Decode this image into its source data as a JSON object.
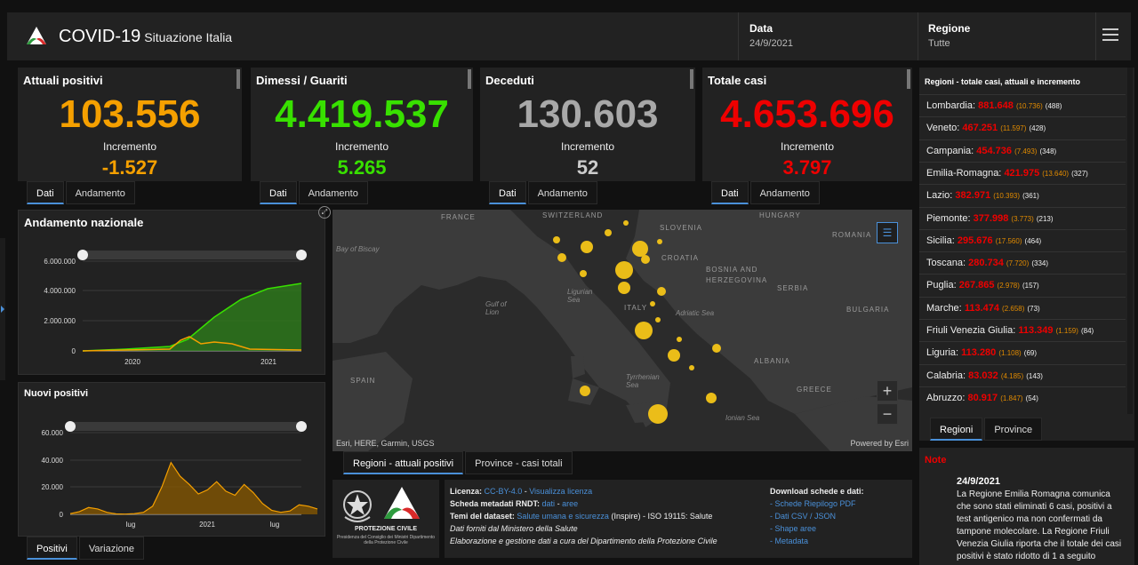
{
  "header": {
    "title": "COVID-19",
    "subtitle": "Situazione Italia",
    "date_label": "Data",
    "date_value": "24/9/2021",
    "region_label": "Regione",
    "region_value": "Tutte"
  },
  "stats": [
    {
      "title": "Attuali positivi",
      "value": "103.556",
      "inc_label": "Incremento",
      "inc": "-1.527",
      "color": "#f5a000"
    },
    {
      "title": "Dimessi / Guariti",
      "value": "4.419.537",
      "inc_label": "Incremento",
      "inc": "5.265",
      "color": "#38e000"
    },
    {
      "title": "Deceduti",
      "value": "130.603",
      "inc_label": "Incremento",
      "inc": "52",
      "color": "#a8a8a8"
    },
    {
      "title": "Totale casi",
      "value": "4.653.696",
      "inc_label": "Incremento",
      "inc": "3.797",
      "color": "#ee0000"
    }
  ],
  "stat_tabs": {
    "dati": "Dati",
    "andamento": "Andamento"
  },
  "trend_chart": {
    "title": "Andamento nazionale",
    "chart_data": {
      "type": "area",
      "x": [
        "2020-02",
        "2020-06",
        "2020-10",
        "2020-12",
        "2021-03",
        "2021-06",
        "2021-09"
      ],
      "yticks": [
        "6.000.000",
        "4.000.000",
        "2.000.000",
        "0"
      ],
      "xticks": [
        "2020",
        "2021"
      ],
      "ylim": [
        0,
        6000000
      ],
      "series": [
        {
          "values": [
            0,
            150000,
            300000,
            1200000,
            2500000,
            3900000,
            4420000
          ],
          "color": "#38e000"
        },
        {
          "values": [
            0,
            20000,
            200000,
            700000,
            550000,
            200000,
            103556
          ],
          "color": "#f5a000"
        }
      ]
    }
  },
  "new_chart": {
    "title": "Nuovi positivi",
    "chart_data": {
      "type": "area",
      "yticks": [
        "60.000",
        "40.000",
        "20.000",
        "0"
      ],
      "xticks": [
        "lug",
        "2021",
        "lug"
      ],
      "ylim": [
        0,
        60000
      ],
      "values": [
        500,
        2000,
        5000,
        4000,
        1500,
        300,
        200,
        500,
        1500,
        6000,
        20000,
        38000,
        28000,
        22000,
        15000,
        18000,
        24000,
        17000,
        14000,
        22000,
        16000,
        8000,
        3000,
        1500,
        2500,
        7000,
        6000,
        4000
      ],
      "color": "#f5a000"
    }
  },
  "bottom_tabs": {
    "positivi": "Positivi",
    "variazione": "Variazione"
  },
  "map": {
    "labels": [
      "FRANCE",
      "SWITZERLAND",
      "SLOVENIA",
      "HUNGARY",
      "ROMANIA",
      "CROATIA",
      "BOSNIA AND HERZEGOVINA",
      "SERBIA",
      "BULGARIA",
      "ITALY",
      "ALBANIA",
      "GREECE",
      "SPAIN"
    ],
    "seas": [
      "Bay of Biscay",
      "Ligurian Sea",
      "Gulf of Lion",
      "Adriatic Sea",
      "Tyrrhenian Sea",
      "Ionian Sea"
    ],
    "attribution": "Esri, HERE, Garmin, USGS",
    "powered": "Powered by Esri",
    "tabs": [
      "Regioni - attuali positivi",
      "Province - casi totali"
    ]
  },
  "regions": {
    "title": "Regioni - totale casi, attuali e incremento",
    "items": [
      {
        "name": "Lombardia:",
        "total": "881.648",
        "act": "(10.736)",
        "inc": "(488)"
      },
      {
        "name": "Veneto:",
        "total": "467.251",
        "act": "(11.597)",
        "inc": "(428)"
      },
      {
        "name": "Campania:",
        "total": "454.736",
        "act": "(7.493)",
        "inc": "(348)"
      },
      {
        "name": "Emilia-Romagna:",
        "total": "421.975",
        "act": "(13.640)",
        "inc": "(327)"
      },
      {
        "name": "Lazio:",
        "total": "382.971",
        "act": "(10.393)",
        "inc": "(361)"
      },
      {
        "name": "Piemonte:",
        "total": "377.998",
        "act": "(3.773)",
        "inc": "(213)"
      },
      {
        "name": "Sicilia:",
        "total": "295.676",
        "act": "(17.560)",
        "inc": "(464)"
      },
      {
        "name": "Toscana:",
        "total": "280.734",
        "act": "(7.720)",
        "inc": "(334)"
      },
      {
        "name": "Puglia:",
        "total": "267.865",
        "act": "(2.978)",
        "inc": "(157)"
      },
      {
        "name": "Marche:",
        "total": "113.474",
        "act": "(2.658)",
        "inc": "(73)"
      },
      {
        "name": "Friuli Venezia Giulia:",
        "total": "113.349",
        "act": "(1.159)",
        "inc": "(84)"
      },
      {
        "name": "Liguria:",
        "total": "113.280",
        "act": "(1.108)",
        "inc": "(69)"
      },
      {
        "name": "Calabria:",
        "total": "83.032",
        "act": "(4.185)",
        "inc": "(143)"
      },
      {
        "name": "Abruzzo:",
        "total": "80.917",
        "act": "(1.847)",
        "inc": "(54)"
      }
    ],
    "tabs": [
      "Regioni",
      "Province"
    ]
  },
  "note": {
    "title": "Note",
    "date": "24/9/2021",
    "text": "La Regione Emilia Romagna comunica che sono stati eliminati 6 casi, positivi a test antigenico ma non confermati da tampone molecolare. La Regione Friuli Venezia Giulia riporta che il totale dei casi positivi è stato ridotto di 1 a seguito"
  },
  "footer": {
    "logo_text": "PROTEZIONE CIVILE",
    "logo_small": "Presidenza del Consiglio dei Ministri Dipartimento della Protezione Civile",
    "licenza_label": "Licenza:",
    "licenza_value": "CC-BY-4.0",
    "licenza_link": "Visualizza licenza",
    "scheda_label": "Scheda metadati RNDT:",
    "scheda_dati": "dati",
    "scheda_aree": "aree",
    "temi_label": "Temi del dataset:",
    "temi_link": "Salute umana e sicurezza",
    "temi_rest": "(Inspire) - ISO 19115: Salute",
    "fonte": "Dati forniti dal Ministero della Salute",
    "elaborazione": "Elaborazione e gestione dati a cura del Dipartimento della Protezione Civile",
    "download_title": "Download schede e dati:",
    "downloads": [
      "- Schede Riepilogo PDF",
      "- Dati CSV / JSON",
      "- Shape aree",
      "- Metadata"
    ]
  }
}
